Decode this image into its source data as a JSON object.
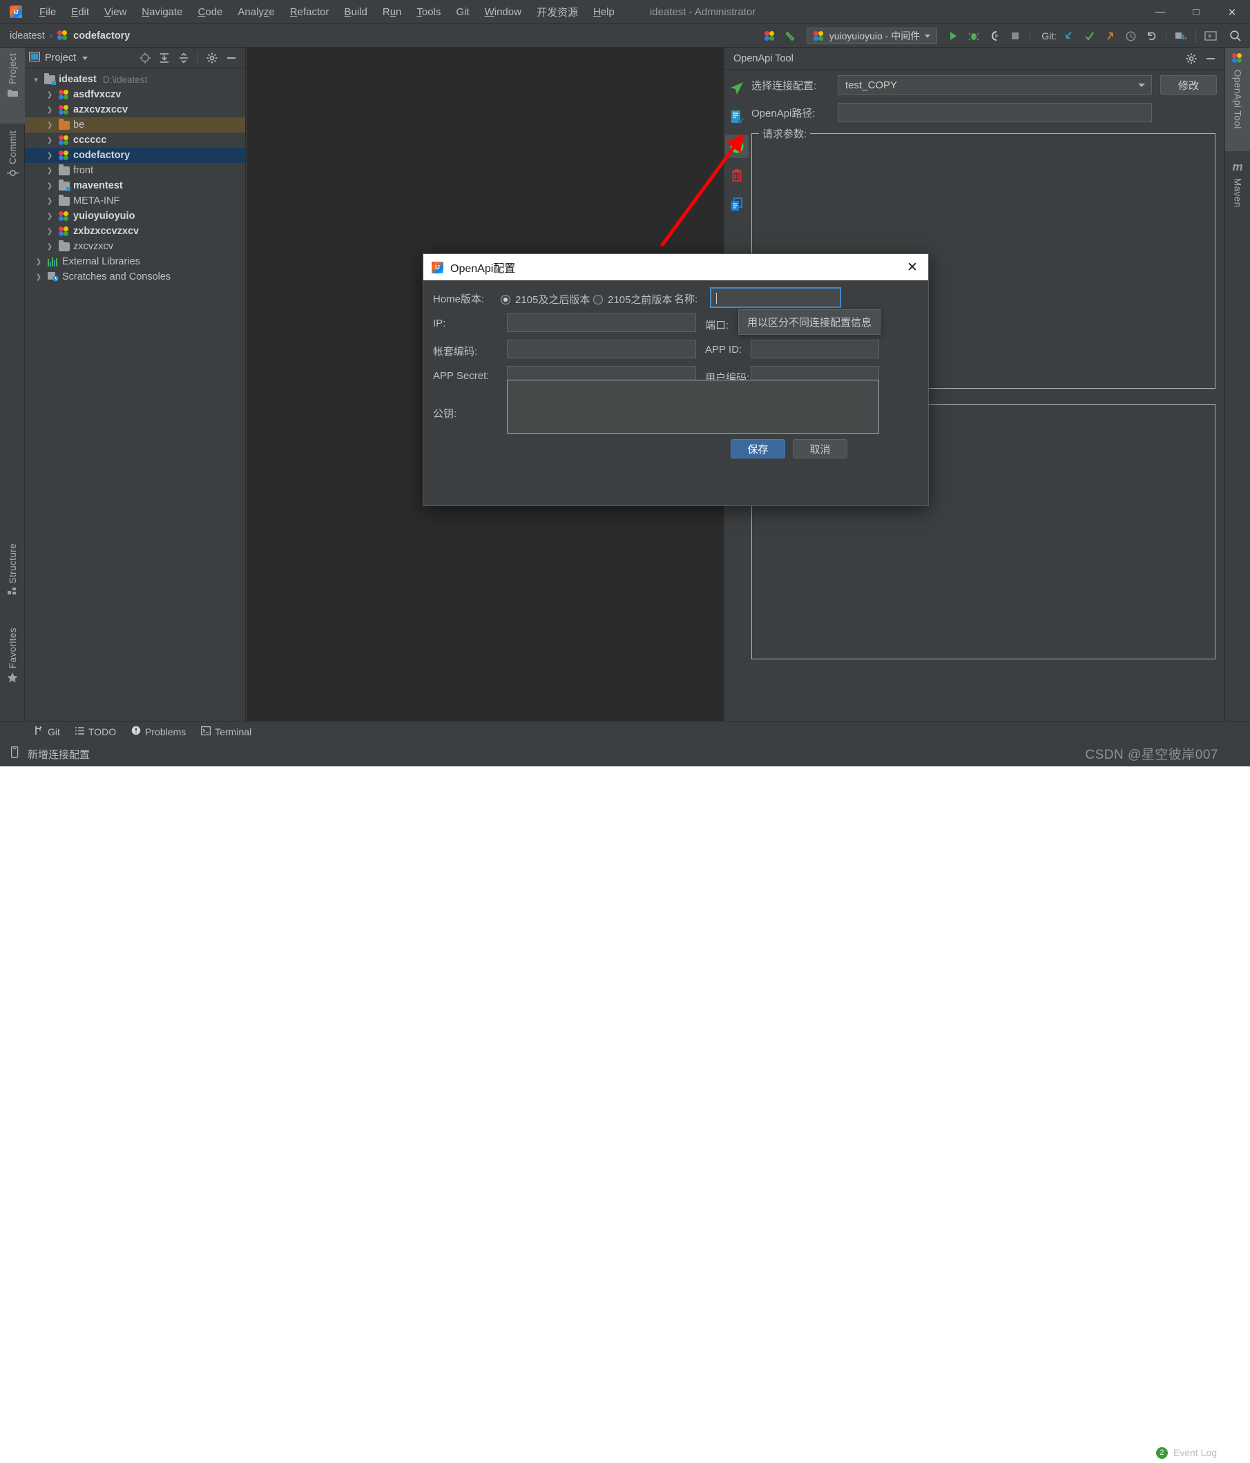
{
  "window": {
    "title": "ideatest - Administrator",
    "logo_icon": "intellij-logo-icon",
    "minimize_label": "—",
    "maximize_label": "□",
    "close_label": "✕"
  },
  "menubar": {
    "items": [
      {
        "label": "File",
        "mnemonic": "F"
      },
      {
        "label": "Edit",
        "mnemonic": "E"
      },
      {
        "label": "View",
        "mnemonic": "V"
      },
      {
        "label": "Navigate",
        "mnemonic": "N"
      },
      {
        "label": "Code",
        "mnemonic": "C"
      },
      {
        "label": "Analyze",
        "mnemonic": "z"
      },
      {
        "label": "Refactor",
        "mnemonic": "R"
      },
      {
        "label": "Build",
        "mnemonic": "B"
      },
      {
        "label": "Run",
        "mnemonic": "u"
      },
      {
        "label": "Tools",
        "mnemonic": "T"
      },
      {
        "label": "Git",
        "mnemonic": ""
      },
      {
        "label": "Window",
        "mnemonic": "W"
      },
      {
        "label": "开发资源",
        "mnemonic": ""
      },
      {
        "label": "Help",
        "mnemonic": "H"
      }
    ]
  },
  "navbar": {
    "breadcrumb": [
      "ideatest",
      "codefactory"
    ],
    "separator": "›",
    "run_config": "yuioyuioyuio - 中间件",
    "git_label": "Git:",
    "icons": [
      "module-icon",
      "build-icon",
      "run-icon",
      "debug-icon",
      "run-coverage-icon",
      "stop-icon",
      "git-update-icon",
      "git-commit-icon",
      "git-push-icon",
      "history-icon",
      "undo-icon",
      "project-structure-icon",
      "select-in-icon",
      "search-everywhere-icon"
    ]
  },
  "left_strip": {
    "tabs": [
      {
        "label": "Project",
        "icon": "folder-icon",
        "selected": true
      },
      {
        "label": "Commit",
        "icon": "commit-icon",
        "selected": false
      },
      {
        "label": "Structure",
        "icon": "structure-icon",
        "selected": false
      },
      {
        "label": "Favorites",
        "icon": "star-icon",
        "selected": false
      }
    ]
  },
  "right_strip": {
    "tabs": [
      {
        "label": "OpenApi Tool",
        "icon": "module-icon",
        "selected": true
      },
      {
        "label": "Maven",
        "icon": "maven-icon",
        "selected": false
      }
    ]
  },
  "project_panel": {
    "title": "Project",
    "toolbar_icons": [
      "locate-icon",
      "expand-all-icon",
      "collapse-all-icon",
      "gear-icon",
      "hide-icon"
    ],
    "tree": [
      {
        "label": "ideatest",
        "sub": "D:\\ideatest",
        "icon": "project-root-icon",
        "indent": 0,
        "expanded": true,
        "bold": true,
        "state": "none"
      },
      {
        "label": "asdfvxczv",
        "sub": "",
        "icon": "module-icon",
        "indent": 1,
        "expanded": false,
        "bold": true,
        "state": "none"
      },
      {
        "label": "azxcvzxccv",
        "sub": "",
        "icon": "module-icon",
        "indent": 1,
        "expanded": false,
        "bold": true,
        "state": "none"
      },
      {
        "label": "be",
        "sub": "",
        "icon": "folder-orange-icon",
        "indent": 1,
        "expanded": false,
        "bold": false,
        "state": "hover"
      },
      {
        "label": "cccccc",
        "sub": "",
        "icon": "module-icon",
        "indent": 1,
        "expanded": false,
        "bold": true,
        "state": "none"
      },
      {
        "label": "codefactory",
        "sub": "",
        "icon": "module-icon",
        "indent": 1,
        "expanded": false,
        "bold": true,
        "state": "selected"
      },
      {
        "label": "front",
        "sub": "",
        "icon": "folder-icon",
        "indent": 1,
        "expanded": false,
        "bold": false,
        "state": "none"
      },
      {
        "label": "maventest",
        "sub": "",
        "icon": "folder-source-icon",
        "indent": 1,
        "expanded": false,
        "bold": true,
        "state": "none"
      },
      {
        "label": "META-INF",
        "sub": "",
        "icon": "folder-icon",
        "indent": 1,
        "expanded": false,
        "bold": false,
        "state": "none"
      },
      {
        "label": "yuioyuioyuio",
        "sub": "",
        "icon": "module-icon",
        "indent": 1,
        "expanded": false,
        "bold": true,
        "state": "none"
      },
      {
        "label": "zxbzxccvzxcv",
        "sub": "",
        "icon": "module-icon",
        "indent": 1,
        "expanded": false,
        "bold": true,
        "state": "none"
      },
      {
        "label": "zxcvzxcv",
        "sub": "",
        "icon": "folder-icon",
        "indent": 1,
        "expanded": false,
        "bold": false,
        "state": "none"
      },
      {
        "label": "External Libraries",
        "sub": "",
        "icon": "libraries-icon",
        "indent": 0,
        "expanded": false,
        "bold": false,
        "state": "none"
      },
      {
        "label": "Scratches and Consoles",
        "sub": "",
        "icon": "scratches-icon",
        "indent": 0,
        "expanded": false,
        "bold": false,
        "state": "none"
      }
    ]
  },
  "openapi_panel": {
    "title": "OpenApi Tool",
    "header_icons": [
      "gear-icon",
      "hide-icon"
    ],
    "action_icons": [
      "send-icon",
      "doc-icon",
      "add-icon",
      "delete-icon",
      "copy-icon"
    ],
    "fields": {
      "connection_label": "选择连接配置:",
      "connection_value": "test_COPY",
      "edit_button": "修改",
      "path_label": "OpenApi路径:",
      "path_value": "",
      "params_legend": "请求参数:"
    }
  },
  "dialog": {
    "title": "OpenApi配置",
    "close_label": "✕",
    "home_version_label": "Home版本:",
    "radio_options": [
      {
        "label": "2105及之后版本",
        "selected": true
      },
      {
        "label": "2105之前版本",
        "selected": false
      }
    ],
    "name_label": "名称:",
    "name_value": "",
    "ip_label": "IP:",
    "ip_value": "",
    "port_label": "端口:",
    "port_value": "",
    "account_label": "帐套编码:",
    "account_value": "",
    "appid_label": "APP ID:",
    "appid_value": "",
    "appsecret_label": "APP Secret:",
    "appsecret_value": "",
    "usercode_label": "用户编码:",
    "usercode_value": "",
    "publickey_label": "公钥:",
    "publickey_value": "",
    "tooltip": "用以区分不同连接配置信息",
    "save_button": "保存",
    "cancel_button": "取消"
  },
  "statusbar": {
    "tool_windows": [
      {
        "label": "Git",
        "icon": "git-branch-icon"
      },
      {
        "label": "TODO",
        "icon": "todo-list-icon"
      },
      {
        "label": "Problems",
        "icon": "problems-icon"
      },
      {
        "label": "Terminal",
        "icon": "terminal-icon"
      }
    ],
    "event_log_label": "Event Log",
    "event_log_count": "2",
    "message": "新增连接配置",
    "message_icon": "document-icon"
  },
  "watermark": {
    "text": "CSDN @星空彼岸007"
  },
  "annotation": {
    "arrow_color": "#ff0000",
    "arrow_name": "red-arrow-annotation"
  },
  "colors": {
    "panel_bg": "#3c3f41",
    "editor_bg": "#2b2b2b",
    "selection_blue": "#1a3a5c",
    "hover_brown": "#5b4f32",
    "accent_blue": "#4a88c7",
    "primary_button": "#3c6a9e",
    "field_bg": "#45494a"
  }
}
